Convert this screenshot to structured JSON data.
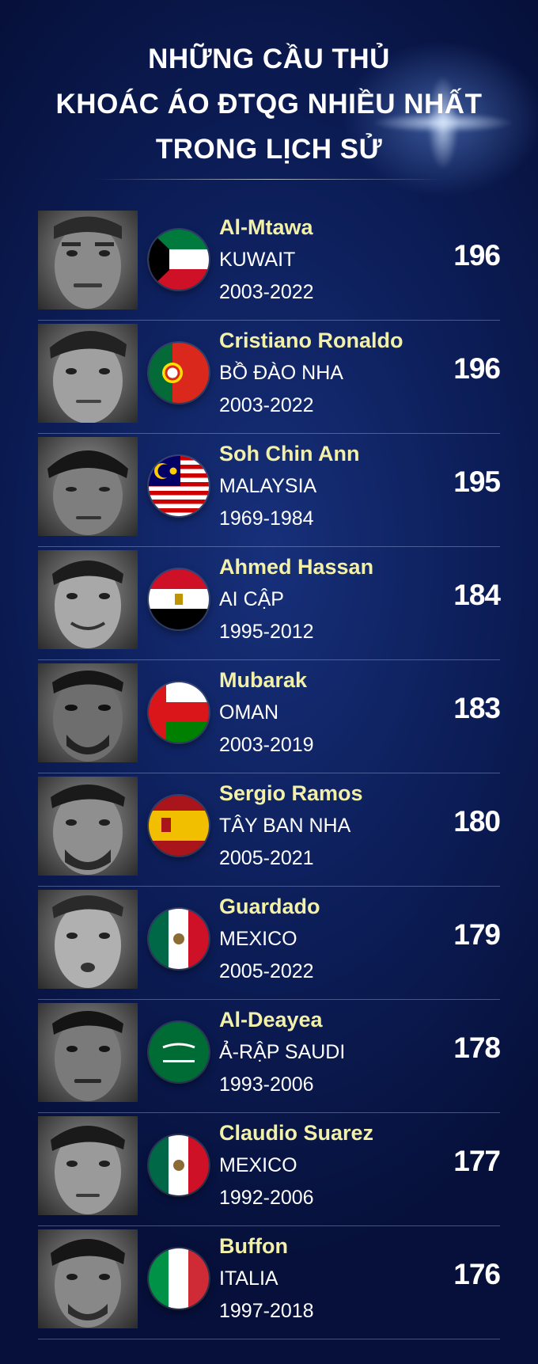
{
  "title": {
    "line1": "NHỮNG CẦU THỦ",
    "line2": "KHOÁC ÁO ĐTQG NHIỀU NHẤT",
    "line3": "TRONG LỊCH SỬ"
  },
  "players": [
    {
      "name": "Al-Mtawa",
      "country": "KUWAIT",
      "years": "2003-2022",
      "caps": "196",
      "flag": "kuwait-flag-icon"
    },
    {
      "name": "Cristiano Ronaldo",
      "country": "BỒ ĐÀO NHA",
      "years": "2003-2022",
      "caps": "196",
      "flag": "portugal-flag-icon"
    },
    {
      "name": "Soh Chin Ann",
      "country": "MALAYSIA",
      "years": "1969-1984",
      "caps": "195",
      "flag": "malaysia-flag-icon"
    },
    {
      "name": "Ahmed Hassan",
      "country": "AI CẬP",
      "years": "1995-2012",
      "caps": "184",
      "flag": "egypt-flag-icon"
    },
    {
      "name": "Mubarak",
      "country": "OMAN",
      "years": "2003-2019",
      "caps": "183",
      "flag": "oman-flag-icon"
    },
    {
      "name": "Sergio Ramos",
      "country": "TÂY BAN NHA",
      "years": "2005-2021",
      "caps": "180",
      "flag": "spain-flag-icon"
    },
    {
      "name": "Guardado",
      "country": "MEXICO",
      "years": "2005-2022",
      "caps": "179",
      "flag": "mexico-flag-icon"
    },
    {
      "name": "Al-Deayea",
      "country": "Ả-RẬP SAUDI",
      "years": "1993-2006",
      "caps": "178",
      "flag": "saudi-arabia-flag-icon"
    },
    {
      "name": "Claudio Suarez",
      "country": "MEXICO",
      "years": "1992-2006",
      "caps": "177",
      "flag": "mexico-flag-icon"
    },
    {
      "name": "Buffon",
      "country": "ITALIA",
      "years": "1997-2018",
      "caps": "176",
      "flag": "italy-flag-icon"
    }
  ],
  "colors": {
    "background": "#0c1d57",
    "name_text": "#f3f0a8",
    "body_text": "#ffffff"
  }
}
